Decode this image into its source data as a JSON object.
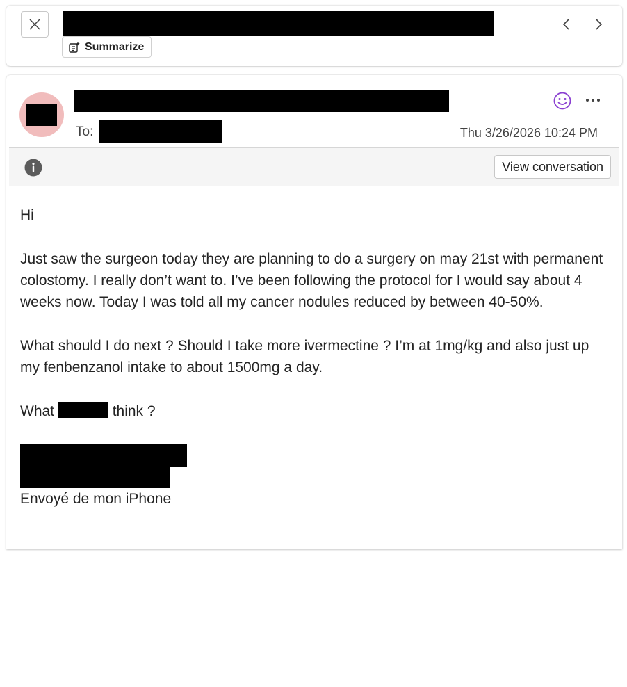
{
  "header": {
    "summarize_label": "Summarize"
  },
  "message": {
    "to_label": "To:",
    "timestamp": "Thu 3/26/2026 10:24 PM",
    "view_conversation_label": "View conversation",
    "body": {
      "greeting": "Hi",
      "paragraph_1": "Just saw the surgeon today they are planning to do a surgery on may 21st with permanent colostomy. I really don’t want to. I’ve been following the protocol for I would say about 4 weeks now. Today I was told all my cancer nodules reduced by between 40-50%.",
      "paragraph_2": "What should I do next ? Should I take more ivermectine ? I’m at 1mg/kg and also just up my fenbenzanol intake to about 1500mg a day.",
      "question_start": "What",
      "question_end": "think ?",
      "signature_footer": "Envoyé de mon iPhone"
    }
  },
  "colors": {
    "avatar_bg": "#f1bcbc",
    "emoji_accent": "#8a3fd1",
    "redaction": "#000000"
  },
  "icons": {
    "close": "close-icon",
    "summarize": "summarize-icon",
    "prev": "chevron-left-icon",
    "next": "chevron-right-icon",
    "emoji": "smiley-icon",
    "more": "more-icon",
    "info": "info-icon"
  }
}
